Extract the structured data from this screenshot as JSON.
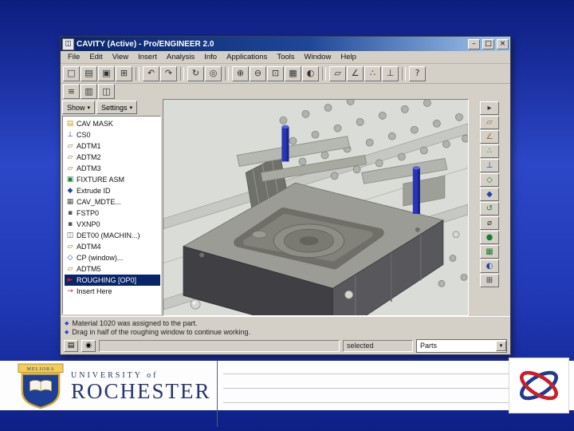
{
  "app": {
    "title": "CAVITY (Active) - Pro/ENGINEER 2.0",
    "window_buttons": {
      "minimize": "–",
      "maximize": "□",
      "close": "×"
    },
    "menu": [
      "File",
      "Edit",
      "View",
      "Insert",
      "Analysis",
      "Info",
      "Applications",
      "Tools",
      "Window",
      "Help"
    ],
    "toolbar1": [
      {
        "name": "new-file-icon",
        "glyph": "□"
      },
      {
        "name": "open-file-icon",
        "glyph": "▤"
      },
      {
        "name": "save-icon",
        "glyph": "▣"
      },
      {
        "name": "print-icon",
        "glyph": "⊞"
      },
      {
        "name": "undo-icon",
        "glyph": "↶"
      },
      {
        "name": "redo-icon",
        "glyph": "↷"
      },
      {
        "name": "regenerate-icon",
        "glyph": "↻"
      },
      {
        "name": "search-icon",
        "glyph": "◎"
      },
      {
        "name": "zoom-in-icon",
        "glyph": "⊕"
      },
      {
        "name": "zoom-out-icon",
        "glyph": "⊖"
      },
      {
        "name": "refit-icon",
        "glyph": "⊡"
      },
      {
        "name": "repaint-icon",
        "glyph": "▦"
      },
      {
        "name": "saved-views-icon",
        "glyph": "◐"
      },
      {
        "name": "datum-plane-icon",
        "glyph": "▱"
      },
      {
        "name": "datum-axis-icon",
        "glyph": "∠"
      },
      {
        "name": "datum-point-icon",
        "glyph": "∴"
      },
      {
        "name": "csys-icon",
        "glyph": "⊥"
      },
      {
        "name": "help-icon",
        "glyph": "?"
      }
    ],
    "toolbar2": [
      {
        "name": "model-tree-icon",
        "glyph": "≡"
      },
      {
        "name": "layers-icon",
        "glyph": "▥"
      },
      {
        "name": "view-manager-icon",
        "glyph": "◫"
      }
    ],
    "tree_header": {
      "show": "Show",
      "settings": "Settings",
      "arrow": "▾"
    },
    "tree": [
      {
        "label": "CAV MASK",
        "glyph": "▤"
      },
      {
        "label": "CS0",
        "glyph": "⊥"
      },
      {
        "label": "ADTM1",
        "glyph": "▱"
      },
      {
        "label": "ADTM2",
        "glyph": "▱"
      },
      {
        "label": "ADTM3",
        "glyph": "▱"
      },
      {
        "label": "FIXTURE ASM",
        "glyph": "▣"
      },
      {
        "label": "Extrude ID",
        "glyph": "◆"
      },
      {
        "label": "CAV_MDTE...",
        "glyph": "▦"
      },
      {
        "label": "FSTP0",
        "glyph": "▪"
      },
      {
        "label": "VXNP0",
        "glyph": "▪"
      },
      {
        "label": "DET00 (MACHIN...)",
        "glyph": "◫"
      },
      {
        "label": "ADTM4",
        "glyph": "▱"
      },
      {
        "label": "CP (window)...",
        "glyph": "◇"
      },
      {
        "label": "ADTM5",
        "glyph": "▱"
      },
      {
        "label": "ROUGHING [OP0]",
        "glyph": "►"
      },
      {
        "label": "Insert Here",
        "glyph": "→"
      }
    ],
    "right_tools": [
      {
        "name": "select-arrow-icon",
        "glyph": "▸"
      },
      {
        "name": "datum-plane-icon",
        "glyph": "▱"
      },
      {
        "name": "datum-axis-icon",
        "glyph": "∠"
      },
      {
        "name": "datum-point-icon",
        "glyph": "∴"
      },
      {
        "name": "csys-icon",
        "glyph": "⊥"
      },
      {
        "name": "sketch-icon",
        "glyph": "◇"
      },
      {
        "name": "extrude-icon",
        "glyph": "◆"
      },
      {
        "name": "revolve-icon",
        "glyph": "↺"
      },
      {
        "name": "hole-icon",
        "glyph": "⌀"
      },
      {
        "name": "round-icon",
        "glyph": "●"
      },
      {
        "name": "pattern-icon",
        "glyph": "▦"
      },
      {
        "name": "shade-icon",
        "glyph": "◐"
      },
      {
        "name": "print-icon",
        "glyph": "⊞"
      }
    ],
    "bottom_icons": [
      {
        "name": "clipboard-icon",
        "glyph": "▤"
      },
      {
        "name": "camera-icon",
        "glyph": "◉"
      }
    ],
    "status": {
      "bullet": "◆",
      "line1": "Material 1020 was assigned to the part.",
      "line2": "Drag in half of the roughing window to continue working.",
      "selected": "selected",
      "filter": "Parts"
    }
  },
  "footer": {
    "univ_small": "UNIVERSITY of",
    "univ_big": "ROCHESTER",
    "motto": "MELIORA"
  },
  "colors": {
    "titlebar_start": "#0a246a",
    "titlebar_end": "#a6caf0",
    "selection": "#0a246a",
    "slide_blue": "#2038b4",
    "rochester_blue": "#26366f",
    "shield_gold": "#d9a82c",
    "logo_blue": "#1f3a93",
    "logo_red": "#c8202b",
    "clamp_pin_blue": "#2a35b4"
  }
}
